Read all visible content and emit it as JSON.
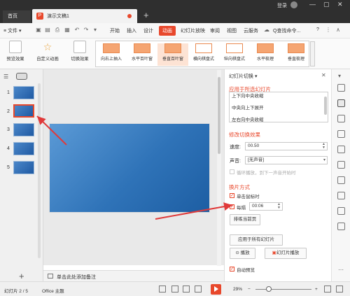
{
  "titlebar": {
    "home_tab": "首页",
    "doc_name": "演示文稿1",
    "new_tab": "+",
    "login": "登录",
    "minimize": "—",
    "maximize": "▢",
    "close": "✕"
  },
  "menubar": {
    "file": "≡ 文件 ▾",
    "items": [
      "开始",
      "插入",
      "设计",
      "动画",
      "幻灯片放映",
      "审阅",
      "视图",
      "云服务"
    ],
    "active": "动画",
    "search": "Q查找命令...",
    "help": "?"
  },
  "ribbon": {
    "preview": "预览效果",
    "custom_anim": "自定义动画",
    "switch_effect": "切换效果",
    "gallery": [
      "向右上抽入",
      "水平百叶窗",
      "垂直百叶窗",
      "横向棋盘式",
      "纵向棋盘式",
      "水平梳理",
      "垂直梳理"
    ],
    "gallery_selected": "垂直百叶窗"
  },
  "slides": [
    {
      "num": "1"
    },
    {
      "num": "2",
      "active": true
    },
    {
      "num": "3"
    },
    {
      "num": "4"
    },
    {
      "num": "5"
    }
  ],
  "notes_placeholder": "单击此处添加备注",
  "panel": {
    "title": "幻灯片切换 ▾",
    "section_apply": "应用于所选幻灯片",
    "effects": [
      "上下向中央收缩",
      "中央向上下展开",
      "左右向中央收缩"
    ],
    "section_modify": "修改切换效果",
    "speed_label": "速度:",
    "speed_value": "00.50",
    "sound_label": "声音:",
    "sound_value": "[无声音]",
    "loop_sound": "循环播放，到下一声音开始时",
    "section_advance": "换片方式",
    "on_click": "单击鼠标时",
    "every": "每隔",
    "every_value": "00:06",
    "rehearse": "排练当前页",
    "apply_all": "应用于所有幻灯片",
    "play": "播放",
    "slideshow": "幻灯片播放",
    "auto_preview": "自动预览"
  },
  "statusbar": {
    "slide_info": "幻灯片 2 / 5",
    "theme": "Office 主题",
    "zoom": "29%",
    "zoom_minus": "−",
    "zoom_plus": "+"
  },
  "colors": {
    "accent": "#e8482c",
    "slide_blue": "#2f73b8",
    "titlebar": "#2f2f2f"
  }
}
